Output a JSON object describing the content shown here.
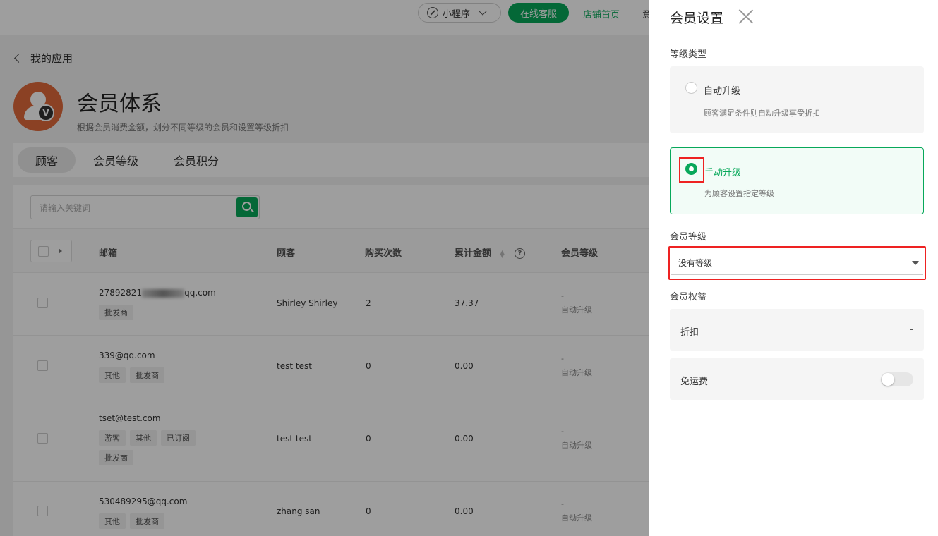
{
  "topbar": {
    "mini_program": "小程序",
    "online_service": "在线客服",
    "shop_home": "店铺首页",
    "cut_text": "意"
  },
  "page": {
    "back_label": "我的应用",
    "title": "会员体系",
    "subtitle": "根据会员消费金额，划分不同等级的会员和设置等级折扣",
    "logo_badge": "V"
  },
  "tabs": [
    {
      "label": "顾客",
      "active": true
    },
    {
      "label": "会员等级",
      "active": false
    },
    {
      "label": "会员积分",
      "active": false
    }
  ],
  "search": {
    "placeholder": "请输入关键词"
  },
  "table": {
    "headers": {
      "email": "邮箱",
      "customer": "顾客",
      "purchases": "购买次数",
      "amount": "累计金额",
      "help": "?",
      "level": "会员等级"
    },
    "rows": [
      {
        "email_prefix": "27892821",
        "email_suffix": "qq.com",
        "tags": [
          "批发商"
        ],
        "customer": "Shirley Shirley",
        "purchases": "2",
        "amount": "37.37",
        "level": "-",
        "level_type": "自动升级"
      },
      {
        "email_prefix": "339@qq.com",
        "email_suffix": "",
        "tags": [
          "其他",
          "批发商"
        ],
        "customer": "test test",
        "purchases": "0",
        "amount": "0.00",
        "level": "-",
        "level_type": "自动升级"
      },
      {
        "email_prefix": "tset@test.com",
        "email_suffix": "",
        "tags": [
          "游客",
          "其他",
          "已订阅",
          "批发商"
        ],
        "customer": "test test",
        "purchases": "0",
        "amount": "0.00",
        "level": "-",
        "level_type": "自动升级"
      },
      {
        "email_prefix": "530489295@qq.com",
        "email_suffix": "",
        "tags": [
          "其他",
          "批发商"
        ],
        "customer": "zhang san",
        "purchases": "0",
        "amount": "0.00",
        "level": "-",
        "level_type": "自动升级"
      }
    ]
  },
  "drawer": {
    "title": "会员设置",
    "level_type_label": "等级类型",
    "options": [
      {
        "title": "自动升级",
        "desc": "顾客满足条件则自动升级享受折扣",
        "selected": false
      },
      {
        "title": "手动升级",
        "desc": "为顾客设置指定等级",
        "selected": true
      }
    ],
    "level_label": "会员等级",
    "level_value": "没有等级",
    "benefits_label": "会员权益",
    "discount_label": "折扣",
    "discount_value": "-",
    "free_shipping_label": "免运费",
    "free_shipping_on": false
  },
  "colors": {
    "accent": "#07a85a",
    "highlight": "#e22222"
  }
}
